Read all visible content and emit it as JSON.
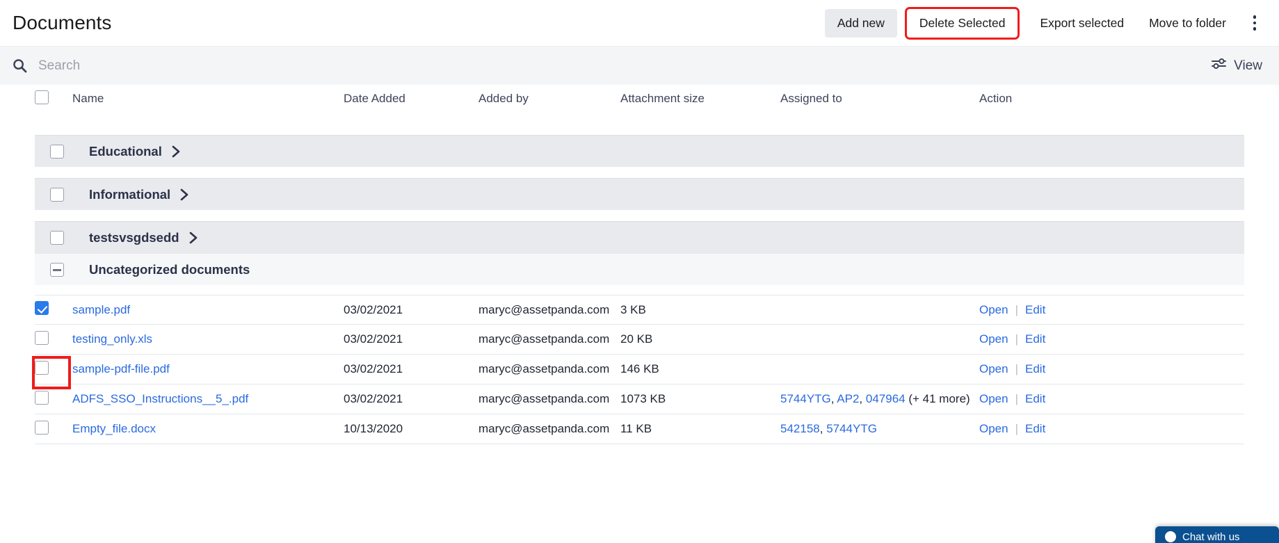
{
  "header": {
    "title": "Documents",
    "buttons": [
      {
        "label": "Add new",
        "style": "filled",
        "name": "add-new-button"
      },
      {
        "label": "Delete Selected",
        "style": "highlighted",
        "name": "delete-selected-button"
      },
      {
        "label": "Export selected",
        "style": "plain",
        "name": "export-selected-button"
      },
      {
        "label": "Move to folder",
        "style": "plain",
        "name": "move-to-folder-button"
      }
    ],
    "kebab_icon": "more-vertical-icon"
  },
  "search": {
    "icon": "search-icon",
    "placeholder": "Search",
    "value": "",
    "view_label": "View",
    "view_icon": "sliders-icon"
  },
  "table": {
    "columns": [
      "Name",
      "Date Added",
      "Added by",
      "Attachment size",
      "Assigned to",
      "Action"
    ],
    "select_all_checked": false,
    "groups": [
      {
        "label": "Educational",
        "checked": false,
        "expanded": false,
        "icon": "chevron-right-icon"
      },
      {
        "label": "Informational",
        "checked": false,
        "expanded": false,
        "icon": "chevron-right-icon"
      },
      {
        "label": "testsvsgdsedd",
        "checked": false,
        "expanded": false,
        "icon": "chevron-right-icon"
      }
    ],
    "uncategorized": {
      "label": "Uncategorized documents",
      "expanded": true,
      "icon": "minus-box-icon"
    },
    "rows": [
      {
        "name": "sample.pdf",
        "date_added": "03/02/2021",
        "added_by": "maryc@assetpanda.com",
        "attachment_size": "3 KB",
        "assigned_to": [],
        "assigned_more": "",
        "actions": [
          "Open",
          "Edit"
        ],
        "checked": true
      },
      {
        "name": "testing_only.xls",
        "date_added": "03/02/2021",
        "added_by": "maryc@assetpanda.com",
        "attachment_size": "20 KB",
        "assigned_to": [],
        "assigned_more": "",
        "actions": [
          "Open",
          "Edit"
        ],
        "checked": false
      },
      {
        "name": "sample-pdf-file.pdf",
        "date_added": "03/02/2021",
        "added_by": "maryc@assetpanda.com",
        "attachment_size": "146 KB",
        "assigned_to": [],
        "assigned_more": "",
        "actions": [
          "Open",
          "Edit"
        ],
        "checked": false
      },
      {
        "name": "ADFS_SSO_Instructions__5_.pdf",
        "date_added": "03/02/2021",
        "added_by": "maryc@assetpanda.com",
        "attachment_size": "1073 KB",
        "assigned_to": [
          "5744YTG",
          "AP2",
          "047964"
        ],
        "assigned_more": "(+ 41 more)",
        "actions": [
          "Open",
          "Edit"
        ],
        "checked": false
      },
      {
        "name": "Empty_file.docx",
        "date_added": "10/13/2020",
        "added_by": "maryc@assetpanda.com",
        "attachment_size": "11 KB",
        "assigned_to": [
          "542158",
          "5744YTG"
        ],
        "assigned_more": "",
        "actions": [
          "Open",
          "Edit"
        ],
        "checked": false
      }
    ],
    "action_separator": "|"
  },
  "chat_widget": {
    "label": "Chat with us",
    "icon": "chat-bubble-icon"
  },
  "colors": {
    "accent_link": "#2a6ae0",
    "checkbox_checked": "#2a7bec",
    "annotation": "#f01c1c",
    "group_bg": "#e9eaee",
    "search_bg": "#f4f5f6",
    "chat_bg": "#0b5090"
  }
}
